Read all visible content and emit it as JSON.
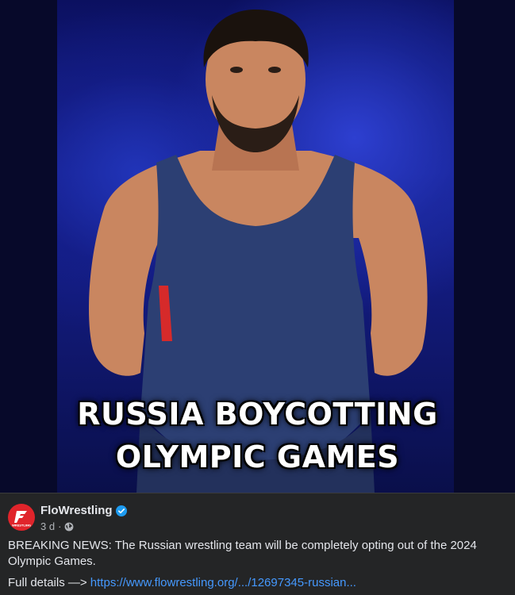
{
  "media": {
    "headline_line1": "RUSSIA BOYCOTTING",
    "headline_line2": "OLYMPIC GAMES",
    "background_color": "#1a2599"
  },
  "post": {
    "author": "FloWrestling",
    "verified_icon": "verified-badge-icon",
    "time": "3 d",
    "separator": "·",
    "privacy_icon": "globe-icon",
    "caption": "BREAKING NEWS: The Russian wrestling team will be completely opting out of the 2024 Olympic Games.",
    "details_prefix": "Full details —>",
    "link_text": "https://www.flowrestling.org/.../12697345-russian...",
    "avatar_text": "WRESTLING",
    "brand_color": "#e0242b",
    "link_color": "#4599ff"
  }
}
